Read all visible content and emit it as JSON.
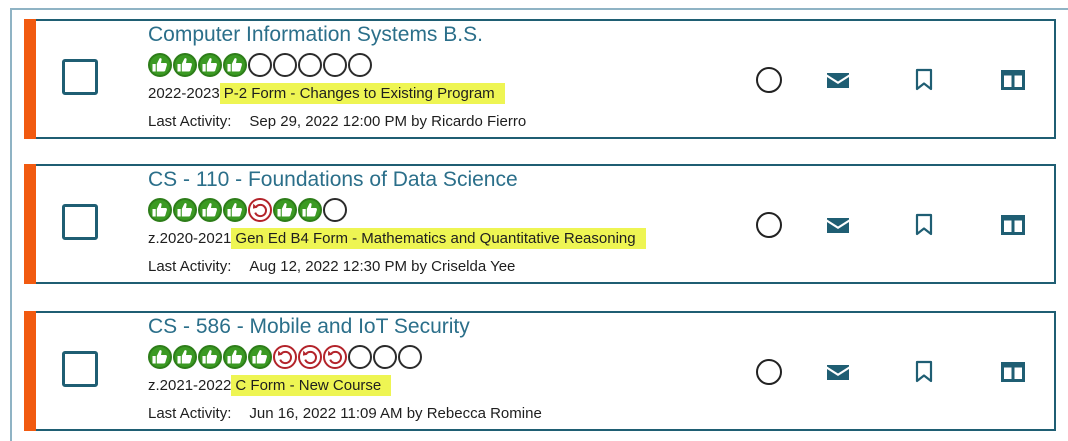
{
  "colors": {
    "accent": "#f15a10",
    "border": "#1f5e73",
    "title": "#2b6f8a",
    "highlight": "#eef553",
    "approved": "#3b9a23",
    "rejected": "#b3232a"
  },
  "icons": {
    "status": "circle-icon",
    "email": "envelope-icon",
    "bookmark": "bookmark-icon",
    "view": "columns-icon"
  },
  "proposals": [
    {
      "title": "Computer Information Systems B.S.",
      "approvals": [
        "approved",
        "approved",
        "approved",
        "approved",
        "pending",
        "pending",
        "pending",
        "pending",
        "pending"
      ],
      "year": "2022-2023",
      "form": "P-2 Form - Changes to Existing Program",
      "last_activity_label": "Last Activity:",
      "last_activity": "Sep 29, 2022 12:00 PM by Ricardo Fierro"
    },
    {
      "title": "CS - 110 - Foundations of Data Science",
      "approvals": [
        "approved",
        "approved",
        "approved",
        "approved",
        "rejected",
        "approved",
        "approved",
        "pending"
      ],
      "year": "z.2020-2021",
      "form": "Gen Ed B4 Form - Mathematics and Quantitative Reasoning",
      "last_activity_label": "Last Activity:",
      "last_activity": "Aug 12, 2022 12:30 PM by Criselda Yee"
    },
    {
      "title": "CS - 586 - Mobile and IoT Security",
      "approvals": [
        "approved",
        "approved",
        "approved",
        "approved",
        "approved",
        "rejected",
        "rejected",
        "rejected",
        "pending",
        "pending",
        "pending"
      ],
      "year": "z.2021-2022",
      "form": "C Form - New Course",
      "last_activity_label": "Last Activity:",
      "last_activity": "Jun 16, 2022 11:09 AM by Rebecca Romine"
    }
  ]
}
